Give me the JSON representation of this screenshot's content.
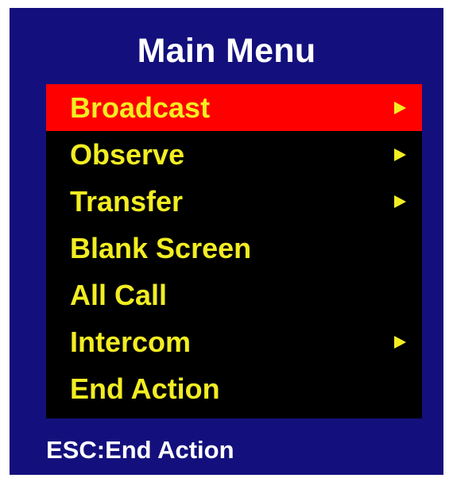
{
  "menu": {
    "title": "Main Menu",
    "items": [
      {
        "label": "Broadcast",
        "has_submenu": true,
        "selected": true
      },
      {
        "label": "Observe",
        "has_submenu": true,
        "selected": false
      },
      {
        "label": "Transfer",
        "has_submenu": true,
        "selected": false
      },
      {
        "label": "Blank Screen",
        "has_submenu": false,
        "selected": false
      },
      {
        "label": "All Call",
        "has_submenu": false,
        "selected": false
      },
      {
        "label": "Intercom",
        "has_submenu": true,
        "selected": false
      },
      {
        "label": "End Action",
        "has_submenu": false,
        "selected": false
      }
    ]
  },
  "status": {
    "hint": "ESC:End Action"
  },
  "colors": {
    "panel_background": "#13107d",
    "list_background": "#000000",
    "selection_highlight": "#ff0000",
    "item_text": "#f2ed22",
    "title_text": "#ffffff"
  },
  "icons": {
    "submenu": "triangle-right-icon"
  }
}
